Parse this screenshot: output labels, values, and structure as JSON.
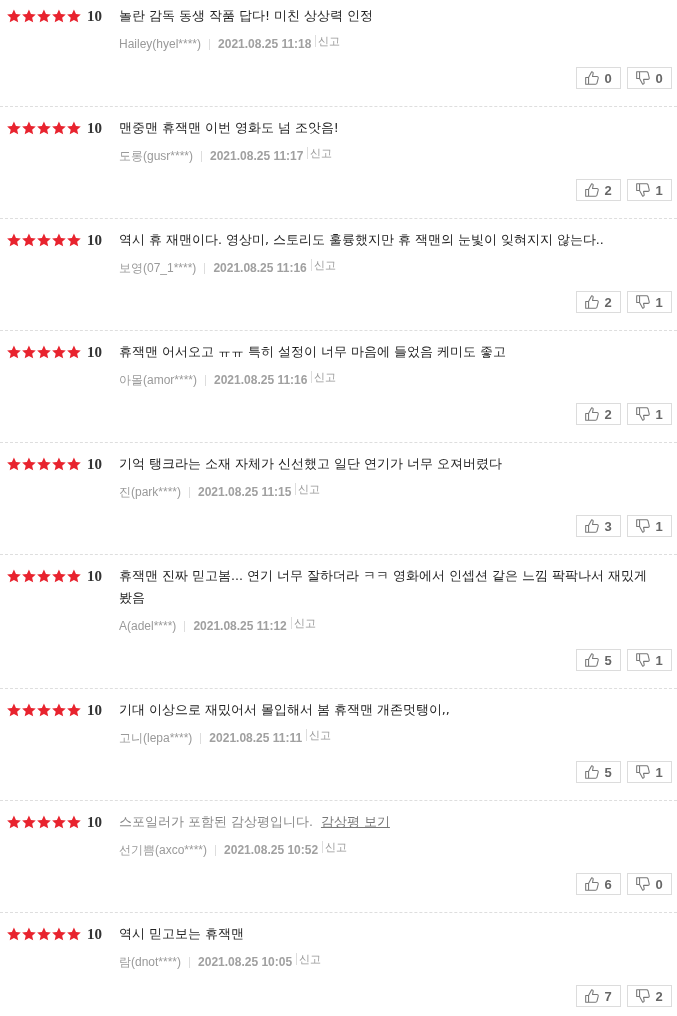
{
  "reviews": [
    {
      "stars": 5,
      "score": "10",
      "kind": "text",
      "text": "놀란 감독 동생 작품 답다! 미친 상상력 인정",
      "author": "Hailey(hyel****)",
      "date": "2021.08.25 11:18",
      "report": "신고",
      "likes": "0",
      "dislikes": "0"
    },
    {
      "stars": 5,
      "score": "10",
      "kind": "text",
      "text": "맨중맨 휴잭맨 이번 영화도 넘 조앗음!",
      "author": "도롱(gusr****)",
      "date": "2021.08.25 11:17",
      "report": "신고",
      "likes": "2",
      "dislikes": "1"
    },
    {
      "stars": 5,
      "score": "10",
      "kind": "text",
      "text": "역시 휴 재맨이다. 영상미, 스토리도 훌륭했지만 휴 잭맨의 눈빛이 잊혀지지 않는다..",
      "author": "보영(07_1****)",
      "date": "2021.08.25 11:16",
      "report": "신고",
      "likes": "2",
      "dislikes": "1"
    },
    {
      "stars": 5,
      "score": "10",
      "kind": "text",
      "text": "휴잭맨 어서오고 ㅠㅠ 특히 설정이 너무 마음에 들었음 케미도 좋고",
      "author": "아몰(amor****)",
      "date": "2021.08.25 11:16",
      "report": "신고",
      "likes": "2",
      "dislikes": "1"
    },
    {
      "stars": 5,
      "score": "10",
      "kind": "text",
      "text": "기억 탱크라는 소재 자체가 신선했고 일단 연기가 너무 오져버렸다",
      "author": "진(park****)",
      "date": "2021.08.25 11:15",
      "report": "신고",
      "likes": "3",
      "dislikes": "1"
    },
    {
      "stars": 5,
      "score": "10",
      "kind": "text",
      "text": "휴잭맨 진짜 믿고봄... 연기 너무 잘하더라 ㅋㅋ 영화에서 인셉션 같은 느낌 팍팍나서 재밌게 봤음",
      "author": "A(adel****)",
      "date": "2021.08.25 11:12",
      "report": "신고",
      "likes": "5",
      "dislikes": "1"
    },
    {
      "stars": 5,
      "score": "10",
      "kind": "text",
      "text": "기대 이상으로 재밌어서 몰입해서 봄 휴잭맨 개존멋탱이,,",
      "author": "고니(lepa****)",
      "date": "2021.08.25 11:11",
      "report": "신고",
      "likes": "5",
      "dislikes": "1"
    },
    {
      "stars": 5,
      "score": "10",
      "kind": "spoiler",
      "text": "스포일러가 포함된 감상평입니다.",
      "link": "감상평 보기",
      "author": "선기쁨(axco****)",
      "date": "2021.08.25 10:52",
      "report": "신고",
      "likes": "6",
      "dislikes": "0"
    },
    {
      "stars": 5,
      "score": "10",
      "kind": "text",
      "text": "역시 믿고보는 휴잭맨",
      "author": "람(dnot****)",
      "date": "2021.08.25 10:05",
      "report": "신고",
      "likes": "7",
      "dislikes": "2"
    }
  ]
}
